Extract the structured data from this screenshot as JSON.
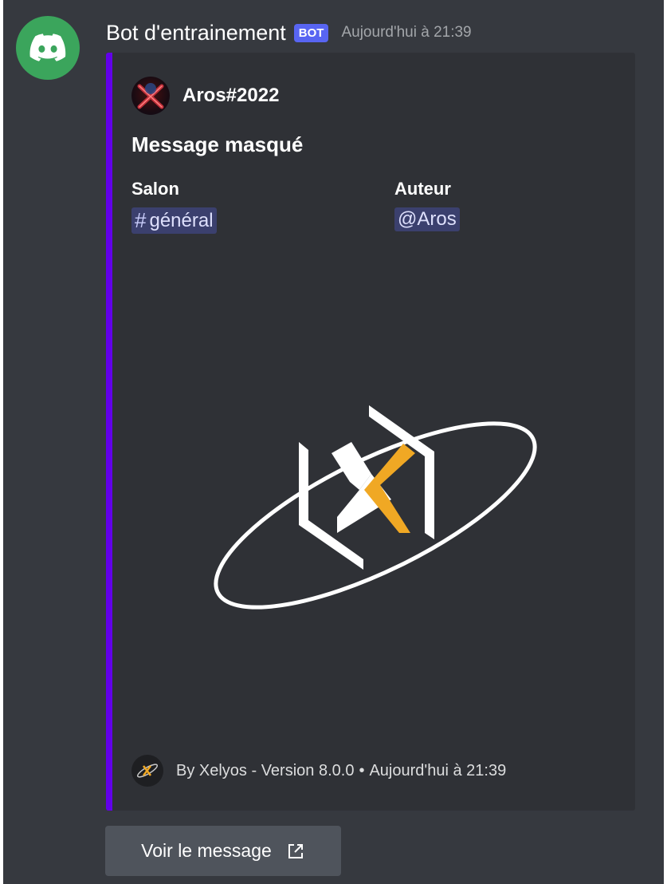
{
  "message": {
    "username": "Bot d'entrainement",
    "bot_tag": "BOT",
    "timestamp": "Aujourd'hui à 21:39"
  },
  "embed": {
    "accent_color": "#6200ea",
    "author": {
      "name": "Aros#2022",
      "icon": "user-avatar"
    },
    "title": "Message masqué",
    "fields": [
      {
        "name": "Salon",
        "value": "général",
        "type": "channel-mention"
      },
      {
        "name": "Auteur",
        "value": "@Aros",
        "type": "user-mention"
      }
    ],
    "image": {
      "icon": "xelyos-logo"
    },
    "footer": {
      "text": "By Xelyos - Version 8.0.0",
      "separator": "•",
      "timestamp": "Aujourd'hui à 21:39",
      "icon": "xelyos-small-logo"
    }
  },
  "button": {
    "label": "Voir le message",
    "icon": "external-link-icon"
  },
  "colors": {
    "avatar_bg": "#3ba55c",
    "bot_tag_bg": "#5865f2",
    "embed_bg": "#2f3136",
    "page_bg": "#36393f"
  }
}
